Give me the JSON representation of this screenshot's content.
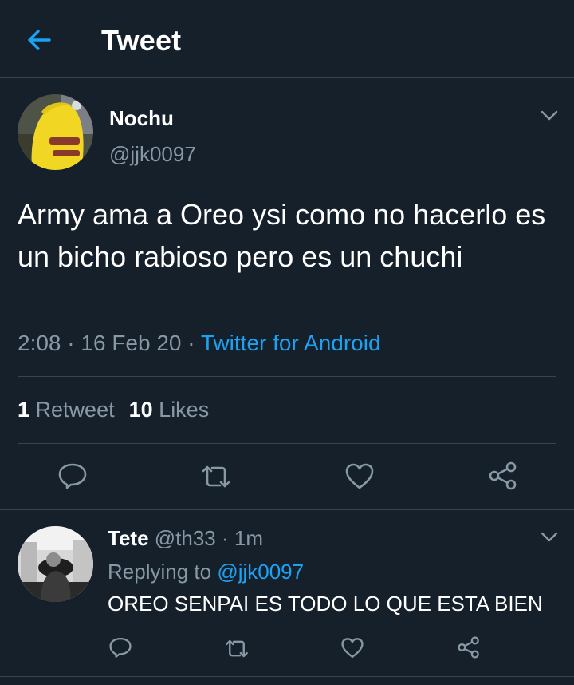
{
  "header": {
    "title": "Tweet",
    "back_icon": "arrow-left-icon"
  },
  "tweet": {
    "author_name": "Nochu",
    "author_handle": "@jjk0097",
    "text": "Army ama a Oreo ysi como no hacerlo es un bicho rabioso pero es un chuchi",
    "time": "2:08",
    "date": "16 Feb 20",
    "separator": "·",
    "source": "Twitter for Android",
    "retweet_count": "1",
    "retweet_label": "Retweet",
    "like_count": "10",
    "like_label": "Likes"
  },
  "reply": {
    "author_name": "Tete",
    "author_handle": "@th33",
    "age": "1m",
    "separator": "·",
    "replying_label": "Replying to",
    "replying_to": "@jjk0097",
    "text": "OREO SENPAI ES TODO LO QUE ESTA BIEN"
  },
  "colors": {
    "background": "#15202b",
    "accent": "#1da1f2",
    "muted": "#8899a6",
    "divider": "#38444d"
  },
  "icons": {
    "reply": "reply-icon",
    "retweet": "retweet-icon",
    "like": "heart-icon",
    "share": "share-icon",
    "more": "chevron-down-icon"
  }
}
